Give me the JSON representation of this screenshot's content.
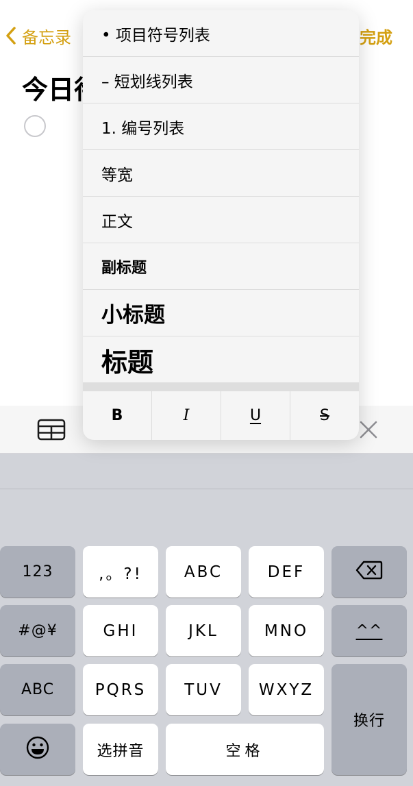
{
  "nav": {
    "back_label": "备忘录",
    "done_label": "完成"
  },
  "note": {
    "title": "今日待办"
  },
  "popup": {
    "items": [
      {
        "label": "• 项目符号列表",
        "style": "list"
      },
      {
        "label": "– 短划线列表",
        "style": "list"
      },
      {
        "label": "1. 编号列表",
        "style": "list"
      },
      {
        "label": "等宽",
        "style": "body"
      },
      {
        "label": "正文",
        "style": "body"
      },
      {
        "label": "副标题",
        "style": "subheading"
      },
      {
        "label": "小标题",
        "style": "heading"
      },
      {
        "label": "标题",
        "style": "title"
      }
    ],
    "styles": {
      "bold": "B",
      "italic": "I",
      "underline": "U",
      "strike": "S"
    }
  },
  "toolbar": {
    "icons": [
      "table-icon",
      "close-icon"
    ]
  },
  "keyboard": {
    "keys": {
      "numbers": "123",
      "punct": ",。?!",
      "abc": "ABC",
      "def": "DEF",
      "symbols": "#@¥",
      "ghi": "GHI",
      "jkl": "JKL",
      "mno": "MNO",
      "emoticon": "^^",
      "abc_switch": "ABC",
      "pqrs": "PQRS",
      "tuv": "TUV",
      "wxyz": "WXYZ",
      "return": "换行",
      "pinyin": "选拼音",
      "space": "空格"
    }
  },
  "colors": {
    "accent": "#d4a012",
    "key_light": "#ffffff",
    "key_dark": "#abafb9",
    "keyboard_bg": "#d1d3d9"
  }
}
